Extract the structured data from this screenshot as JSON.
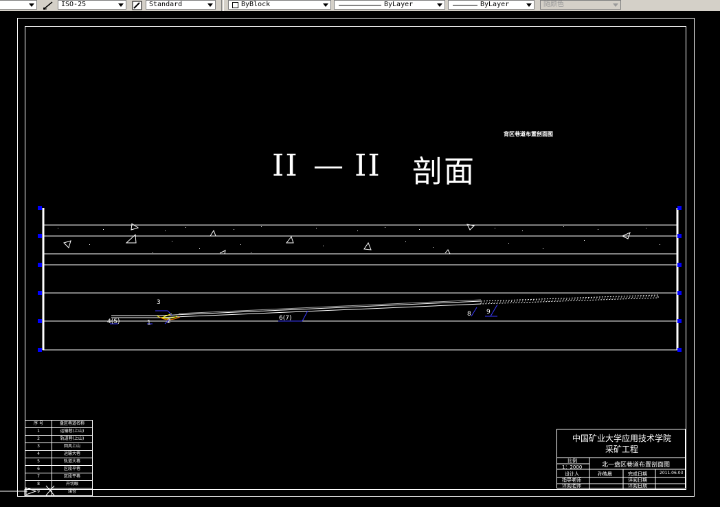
{
  "toolbar": {
    "dimstyle": "ISO-25",
    "textstyle": "Standard",
    "color": "ByBlock",
    "linetype": "ByLayer",
    "lineweight": "ByLayer",
    "plotstyle": "随颜色"
  },
  "drawing": {
    "subtitle": "背区巷道布置剖面图",
    "section_title_left": "II",
    "section_title_dash": "—",
    "section_title_right": "II",
    "section_title_cjk": "剖面",
    "markers": {
      "m3": "3",
      "m1": "1",
      "m2": "2",
      "m45": "4(5)",
      "m67": "6(7)",
      "m8": "8",
      "m9": "9"
    }
  },
  "legend": {
    "header_no": "序 号",
    "header_name": "盘区巷道名称",
    "rows": [
      {
        "no": "1",
        "name": "运输巷(上山)"
      },
      {
        "no": "2",
        "name": "轨道巷(上山)"
      },
      {
        "no": "3",
        "name": "回风上山"
      },
      {
        "no": "4",
        "name": "运输大巷"
      },
      {
        "no": "5",
        "name": "轨道大巷"
      },
      {
        "no": "6",
        "name": "区段平巷"
      },
      {
        "no": "7",
        "name": "区段平巷"
      },
      {
        "no": "8",
        "name": "开切眼"
      },
      {
        "no": "9",
        "name": "煤仓"
      }
    ]
  },
  "titleblock": {
    "school": "中国矿业大学应用技术学院",
    "major": "采矿工程",
    "scale_label": "比例",
    "scale_value": "1：2000",
    "drawing_name": "北一盘区巷道布置剖面图",
    "designer_label": "设计人",
    "designer_name": "孙皓晨",
    "finish_label": "完成日期",
    "finish_date": "2011.06.03",
    "advisor_label": "指导老师",
    "review_date_label": "评阅日期",
    "reviewer_label": "评阅老师",
    "review_date2_label": "评阅日期"
  }
}
